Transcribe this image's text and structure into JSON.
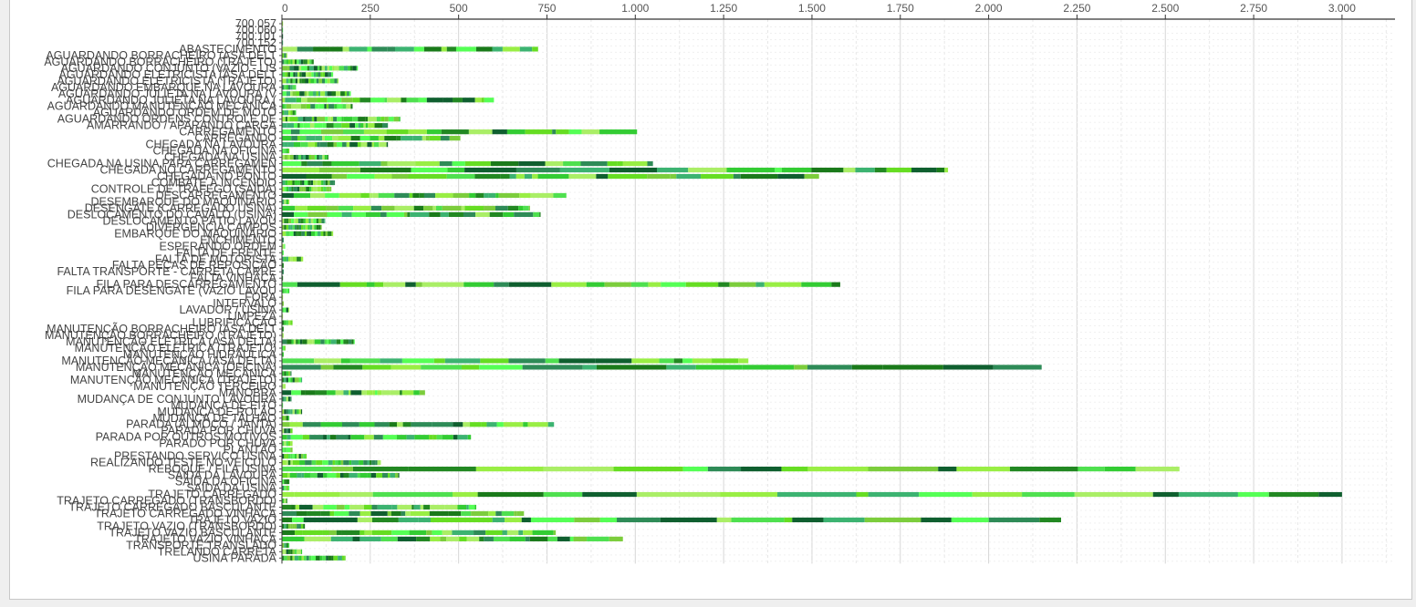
{
  "chart_data": {
    "type": "bar",
    "orientation": "horizontal",
    "stacked": true,
    "title": "",
    "xlabel": "",
    "ylabel": "",
    "xlim": [
      0,
      3150
    ],
    "x_ticks": [
      "0",
      "250",
      "500",
      "750",
      "1.000",
      "1.250",
      "1.500",
      "1.750",
      "2.000",
      "2.250",
      "2.500",
      "2.750",
      "3.000"
    ],
    "x_tick_values": [
      0,
      250,
      500,
      750,
      1000,
      1250,
      1500,
      1750,
      2000,
      2250,
      2500,
      2750,
      3000
    ],
    "grid": true,
    "legend": "none",
    "segment_colors": [
      "#33cc33",
      "#66dd22",
      "#1a7a1a",
      "#99ee44",
      "#2e8b57",
      "#55ff55",
      "#228822",
      "#7ccd3c",
      "#0f5f2f",
      "#aaee66",
      "#3cb371",
      "#4fe04f"
    ],
    "categories": [
      "700.057",
      "700.060",
      "700.101",
      "700.152",
      "ABASTECIMENTO",
      "AGUARDANDO BORRACHEIRO (ASA DELT",
      "AGUARDANDO BORRACHEIRO (TRAJETO)",
      "AGUARDANDO CONJUNTO (VAZIO - LIS",
      "AGUARDANDO ELETRICISTA (ASA DELT",
      "AGUARDANDO ELETRICISTA (TRAJETO)",
      "AGUARDANDO EMBARQUE NA LAVOURA",
      "AGUARDANDO JULIETA NA LAVOURA (V",
      "AGUARDANDO JULIETA NA LAVOURA (",
      "AGUARDANDO MANUTENÇÃO MECÂNICA",
      "AGUARDANDO ORDEM DE MOTO",
      "AGUARDANDO ORDENS CONTROLE DE",
      "AMARRANDO / APARANDO CARGA",
      "CARREGAMENTO",
      "CARREGANDO",
      "CHEGADA NA LAVOURA",
      "CHEGADA NA OFICINA",
      "CHEGADA NA USINA",
      "CHEGADA NA USINA PARA CARREGAMEN",
      "CHEGADA NO CARREGAMENTO",
      "CHEGADA NO PONTO",
      "COMBATE À INCÊNDIO",
      "CONTROLE DE TRÁFEGO (SAÍDA)",
      "DESCARREGAMENTO",
      "DESEMBARQUE DO MAQUINÁRIO",
      "DESENGATE (CARREGADO USINA)",
      "DESLOCAMENTO DO CAVALO (USINA)",
      "DESLOCAMENTO PÁTIO LAVOU",
      "DIVERGÊNCIA CAMPOS",
      "EMBARQUE DO MAQUINÁRIO",
      "ENCHIMENTO",
      "ESPERANDO ORDEM",
      "FALTA DE FRENTE",
      "FALTA DE MOTORISTA",
      "FALTA PEÇAS DE REPOSIÇÃO",
      "FALTA TRANSPORTE - CARRETA CARRE",
      "FALTA VINHAÇA",
      "FILA PARA DESCARREGAMENTO",
      "FILA PARA DESENGATE (VAZIO LAVOU",
      "FORA",
      "INTERVALO",
      "LAVADOR / USINA",
      "LIMPEZA",
      "LUBRIFICAÇÃO",
      "MANUTENÇÃO BORRACHEIRO (ASA DELT",
      "MANUTENÇÃO BORRACHEIRO (TRAJETO)",
      "MANUTENÇÃO ELÉTRICA (ASA DELTA)",
      "MANUTENÇÃO ELÉTRICA (TRAJETO)",
      "MANUTENÇÃO HIDRÁULICA",
      "MANUTENÇÃO MECÂNICA (ASA DELTA)",
      "MANUTENÇÃO MECÂNICA (OFICINA)",
      "MANUTENÇÃO MECÂNICA",
      "MANUTENÇÃO MECÂNICA (TRAJETO)",
      "MANUTENÇÃO TERCEIRO",
      "MANOBRA",
      "MUDANÇA DE CONJUNTO LAVOURA",
      "MUDANÇA DE EITO",
      "MUDANÇA DE ROLÃO",
      "MUDANÇA DE TALHÃO",
      "PARADA (ALMOÇO / JANTA)",
      "PARADA POR CHUVA",
      "PARADA POR OUTROS MOTIVOS",
      "PARADO POR CHUVA",
      "PLANTÃO",
      "PRESTANDO SERVIÇO USINA",
      "REALIZANDO TESTE NO VEÍCULO",
      "REBOQUE / FILA USINA",
      "SAÍDA DA LAVOURA",
      "SAÍDA DA OFICINA",
      "SAÍDA DA USINA",
      "TRAJETO CARREGADO",
      "TRAJETO CARREGADO (TRANSBORDO)",
      "TRAJETO CARREGADO BASCULANTE",
      "TRAJETO CARREGADO VINHAÇA",
      "TRAJETO VAZIO",
      "TRAJETO VAZIO (TRANSBORDO)",
      "TRAJETO VAZIO BASCULANTE",
      "TRAJETO VAZIO VINHAÇA",
      "TRANSPORTE TRANSLADO",
      "TRELANDO CARRETA",
      "USINA PARADA"
    ],
    "values": [
      3,
      3,
      2,
      2,
      725,
      15,
      90,
      215,
      145,
      160,
      40,
      195,
      600,
      200,
      40,
      335,
      300,
      1005,
      505,
      300,
      20,
      130,
      1050,
      1885,
      1520,
      150,
      140,
      805,
      20,
      700,
      730,
      120,
      110,
      145,
      5,
      8,
      5,
      60,
      5,
      5,
      3,
      1580,
      20,
      3,
      5,
      20,
      3,
      30,
      5,
      5,
      205,
      10,
      5,
      1320,
      2150,
      25,
      55,
      10,
      405,
      25,
      3,
      55,
      20,
      770,
      30,
      535,
      30,
      30,
      70,
      280,
      2540,
      330,
      20,
      20,
      3000,
      15,
      550,
      685,
      2205,
      65,
      775,
      965,
      20,
      55,
      180
    ]
  }
}
